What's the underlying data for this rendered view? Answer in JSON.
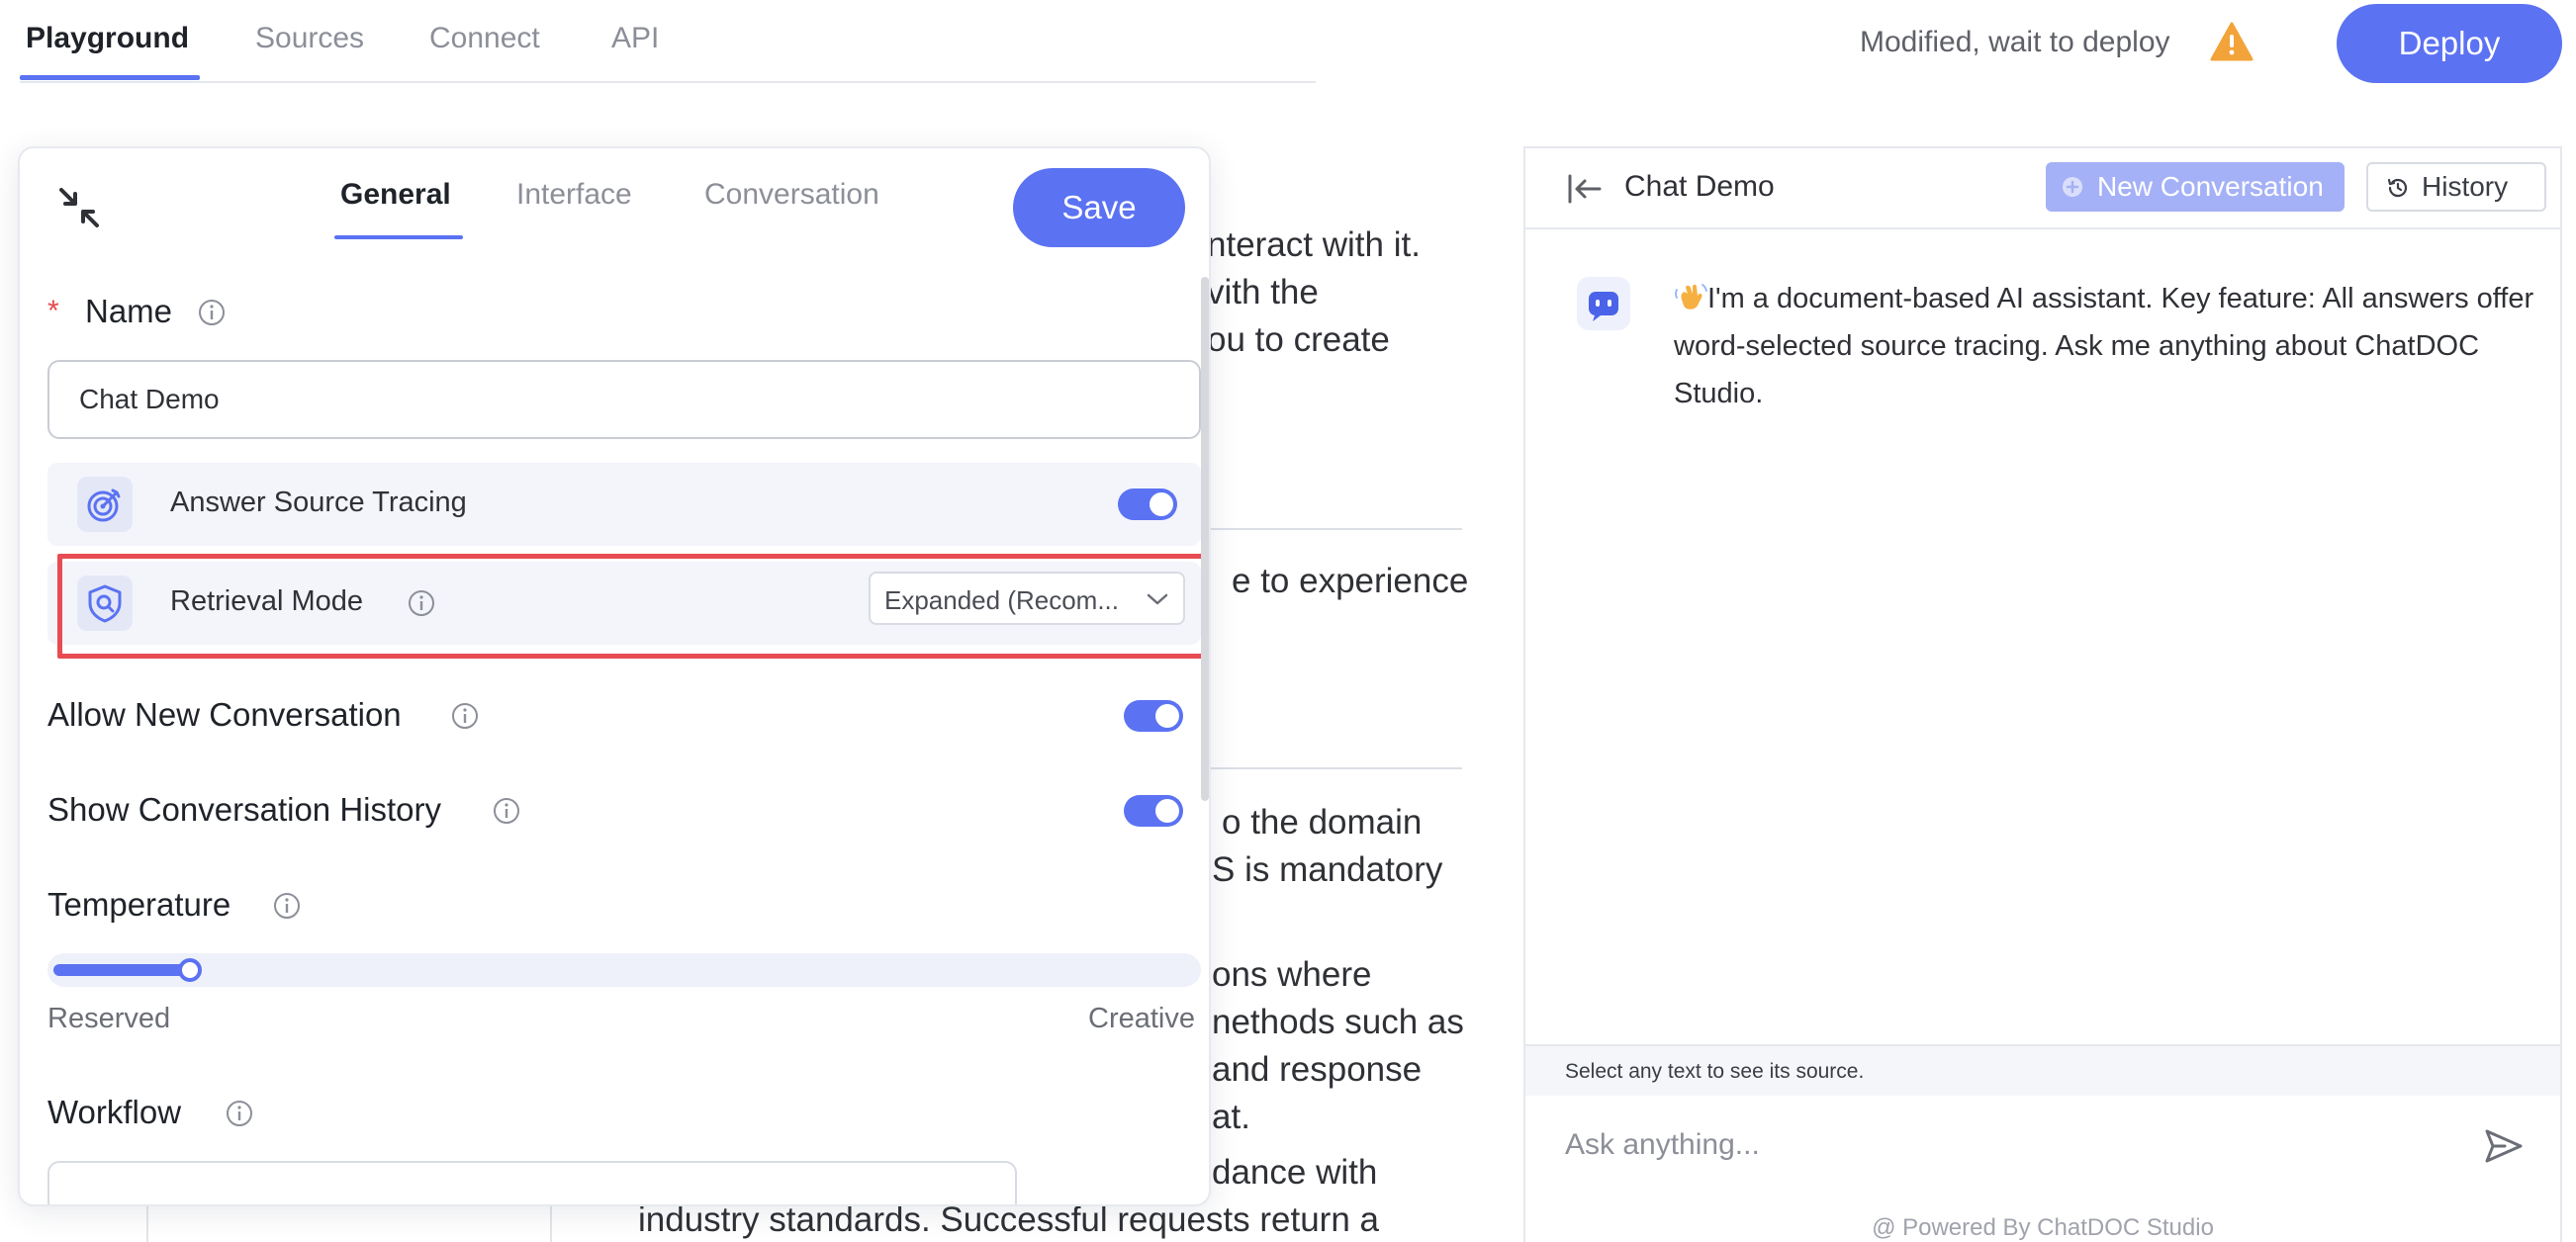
{
  "topnav": {
    "tabs": [
      {
        "label": "Playground",
        "active": true
      },
      {
        "label": "Sources",
        "active": false
      },
      {
        "label": "Connect",
        "active": false
      },
      {
        "label": "API",
        "active": false
      }
    ],
    "deploy_status": "Modified, wait to deploy",
    "deploy_label": "Deploy",
    "warning_icon": "warning-triangle-icon"
  },
  "background_page": {
    "lines": [
      "nteract with it.",
      "vith the",
      "ou to create",
      "e to experience",
      "o the domain",
      "S is mandatory",
      "ons where",
      "nethods such as",
      "and response",
      "at.",
      "dance with",
      "industry standards. Successful requests return a"
    ]
  },
  "settings": {
    "tabs": [
      {
        "label": "General",
        "active": true
      },
      {
        "label": "Interface",
        "active": false
      },
      {
        "label": "Conversation",
        "active": false
      }
    ],
    "save_label": "Save",
    "name_required_mark": "*",
    "name_label": "Name",
    "name_value": "Chat Demo",
    "answer_source_tracing": {
      "label": "Answer Source Tracing",
      "enabled": true
    },
    "retrieval_mode": {
      "label": "Retrieval Mode",
      "selected": "Expanded (Recom..."
    },
    "allow_new_conversation": {
      "label": "Allow New Conversation",
      "enabled": true
    },
    "show_conversation_history": {
      "label": "Show Conversation History",
      "enabled": true
    },
    "temperature": {
      "label": "Temperature",
      "min_label": "Reserved",
      "max_label": "Creative",
      "value_fraction": 0.12
    },
    "workflow_label": "Workflow"
  },
  "chat": {
    "title": "Chat Demo",
    "new_conversation_label": "New Conversation",
    "history_label": "History",
    "bot_message": "I'm a document-based AI assistant. Key feature: All answers offer word-selected source tracing. Ask me anything about ChatDOC Studio.",
    "hint": "Select any text to see its source.",
    "input_placeholder": "Ask anything...",
    "powered_by": "@ Powered By ChatDOC Studio"
  },
  "colors": {
    "accent": "#5b72f2",
    "accent_disabled": "#a5b1f6",
    "highlight": "#e84c52",
    "warning": "#f2a33a"
  }
}
